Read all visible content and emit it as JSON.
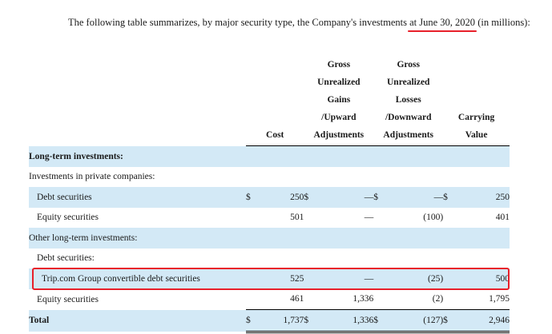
{
  "intro": {
    "text_before": "The following table summarizes, by major security type, the Company's investments ",
    "date": "at June 30, 2020",
    "text_after": " (in millions):"
  },
  "headers": {
    "cost": "Cost",
    "gains": [
      "Gross",
      "Unrealized",
      "Gains",
      "/Upward",
      "Adjustments"
    ],
    "losses": [
      "Gross",
      "Unrealized",
      "Losses",
      "/Downward",
      "Adjustments"
    ],
    "carrying": [
      "Carrying",
      "Value"
    ]
  },
  "rows": {
    "lti": {
      "label": "Long-term investments:"
    },
    "ipc": {
      "label": "Investments in private companies:"
    },
    "debt1": {
      "label": "Debt securities",
      "d1": "$",
      "cost": "250",
      "d2": "$",
      "gains": "—",
      "d3": "$",
      "losses": "—",
      "d4": "$",
      "carrying": "250"
    },
    "eq1": {
      "label": "Equity securities",
      "cost": "501",
      "gains": "—",
      "losses": "(100)",
      "carrying": "401"
    },
    "olti": {
      "label": "Other long-term investments:"
    },
    "debt2": {
      "label": "Debt securities:"
    },
    "trip": {
      "label": "Trip.com Group convertible debt securities",
      "cost": "525",
      "gains": "—",
      "losses": "(25)",
      "carrying": "500"
    },
    "eq2": {
      "label": "Equity securities",
      "cost": "461",
      "gains": "1,336",
      "losses": "(2)",
      "carrying": "1,795"
    },
    "total": {
      "label": "Total",
      "d1": "$",
      "cost": "1,737",
      "d2": "$",
      "gains": "1,336",
      "d3": "$",
      "losses": "(127)",
      "d4": "$",
      "carrying": "2,946"
    }
  }
}
